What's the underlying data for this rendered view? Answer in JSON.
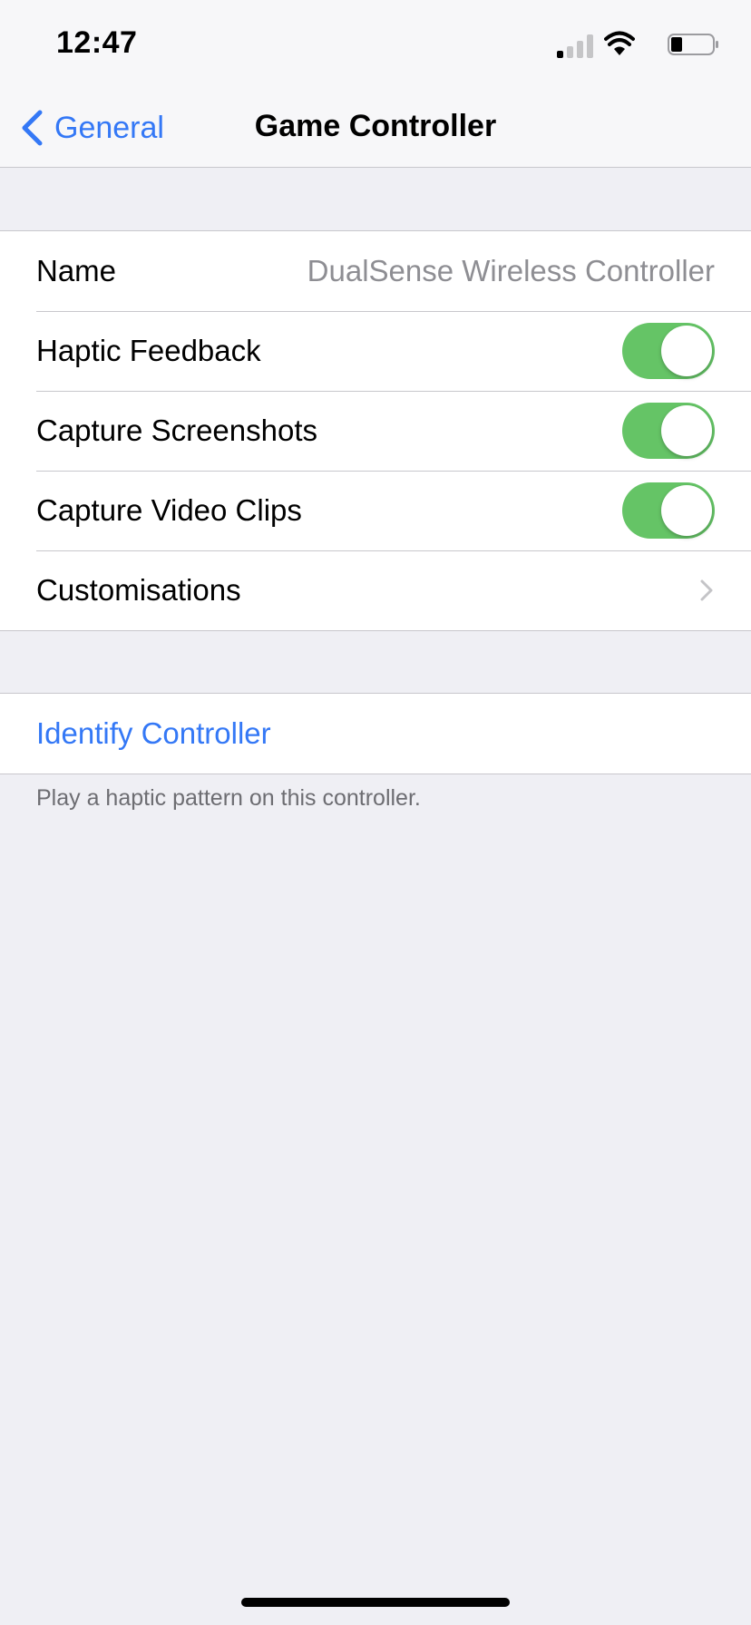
{
  "status_bar": {
    "time": "12:47",
    "icons": [
      "cellular-signal-icon",
      "wifi-icon",
      "battery-icon"
    ]
  },
  "nav": {
    "back_label": "General",
    "title": "Game Controller"
  },
  "settings": {
    "name_label": "Name",
    "name_value": "DualSense Wireless Controller",
    "toggles": [
      {
        "label": "Haptic Feedback",
        "on": true
      },
      {
        "label": "Capture Screenshots",
        "on": true
      },
      {
        "label": "Capture Video Clips",
        "on": true
      }
    ],
    "customisations_label": "Customisations"
  },
  "identify": {
    "label": "Identify Controller",
    "footer": "Play a haptic pattern on this controller."
  },
  "colors": {
    "accent": "#3478f6",
    "toggle_on": "#65c466",
    "background": "#efeff4"
  }
}
